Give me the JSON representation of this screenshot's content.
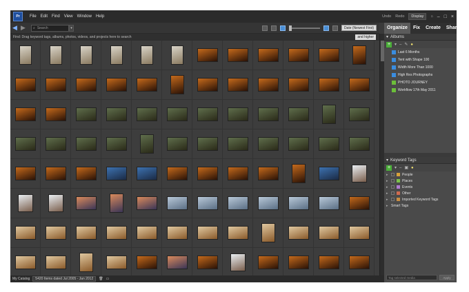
{
  "menu": {
    "logo": "Pr",
    "items": [
      "File",
      "Edit",
      "Find",
      "View",
      "Window",
      "Help"
    ],
    "undo": "Undo",
    "redo": "Redo",
    "display": "Display",
    "window_controls": [
      "–",
      "□",
      "×"
    ]
  },
  "toolbar": {
    "search_placeholder": "Search",
    "sort": "Date (Newest First)"
  },
  "find_bar": {
    "hint": "Find: Drag keyword tags, albums, photos, videos, and projects here to search",
    "rating_filter": "and higher"
  },
  "status": {
    "catalog": "My Catalog",
    "summary": "5420 Items dated Jul 2005 - Jan 2012"
  },
  "panel": {
    "tabs": [
      "Organize",
      "Fix",
      "Create",
      "Share"
    ],
    "albums_title": "Albums",
    "albums": [
      {
        "label": "Last 6 Months",
        "icon_color": "#3a8de0"
      },
      {
        "label": "Tent with Shape 100",
        "icon_color": "#3a8de0"
      },
      {
        "label": "Width More Than 1000",
        "icon_color": "#3a8de0"
      },
      {
        "label": "High Res Photographs",
        "icon_color": "#3a8de0"
      },
      {
        "label": "PHOTO JOURNEY",
        "icon_color": "#6cbf3a"
      },
      {
        "label": "Workflow 17th May 2011",
        "icon_color": "#6cbf3a"
      }
    ],
    "tags_title": "Keyword Tags",
    "tags": [
      {
        "label": "People",
        "icon_color": "#d8a23a"
      },
      {
        "label": "Places",
        "icon_color": "#7cc24a"
      },
      {
        "label": "Events",
        "icon_color": "#b07bd0"
      },
      {
        "label": "Other",
        "icon_color": "#d06a50"
      },
      {
        "label": "Imported Keyword Tags",
        "icon_color": "#c88e42"
      }
    ],
    "smart_tags": "Smart Tags",
    "tag_input_placeholder": "Tag selected media",
    "apply": "Apply"
  },
  "thumbnails": {
    "rows": [
      [
        "doc",
        "doc",
        "doc",
        "doc",
        "doc",
        "doc",
        "warm",
        "warm",
        "warm",
        "warm",
        "warm",
        "warm"
      ],
      [
        "warm",
        "warm",
        "warm",
        "warm",
        "warm",
        "warm",
        "warm",
        "warm",
        "warm",
        "warm",
        "warm",
        "warm"
      ],
      [
        "warm",
        "warm",
        "green",
        "green",
        "green",
        "green",
        "green",
        "green",
        "green",
        "green",
        "green",
        "green"
      ],
      [
        "green",
        "green",
        "green",
        "green",
        "green",
        "green",
        "green",
        "green",
        "green",
        "green",
        "green",
        "green"
      ],
      [
        "warm",
        "warm",
        "warm",
        "blue",
        "blue",
        "warm",
        "warm",
        "warm",
        "warm",
        "warm",
        "blue",
        "face"
      ],
      [
        "face",
        "face",
        "dusk",
        "dusk",
        "dusk",
        "sky",
        "sky",
        "sky",
        "sky",
        "sky",
        "sky",
        "warm"
      ],
      [
        "food",
        "food",
        "food",
        "food",
        "food",
        "food",
        "food",
        "food",
        "food",
        "food",
        "food",
        "food"
      ],
      [
        "food",
        "food",
        "food",
        "food",
        "warm",
        "dusk",
        "warm",
        "face",
        "warm",
        "warm",
        "warm",
        "warm"
      ]
    ],
    "palettes": {
      "doc": [
        "#d9d4c8",
        "#8a7a60"
      ],
      "warm": [
        "#c46a1c",
        "#2a1206"
      ],
      "green": [
        "#5f6e4c",
        "#2a2a18"
      ],
      "blue": [
        "#3d72b0",
        "#1a2a44"
      ],
      "face": [
        "#e9eef2",
        "#7a5e4c"
      ],
      "dusk": [
        "#d98a5c",
        "#3a3556"
      ],
      "sky": [
        "#b8c8d8",
        "#5a6e84"
      ],
      "food": [
        "#e0c8a0",
        "#8a5a2a"
      ]
    }
  }
}
